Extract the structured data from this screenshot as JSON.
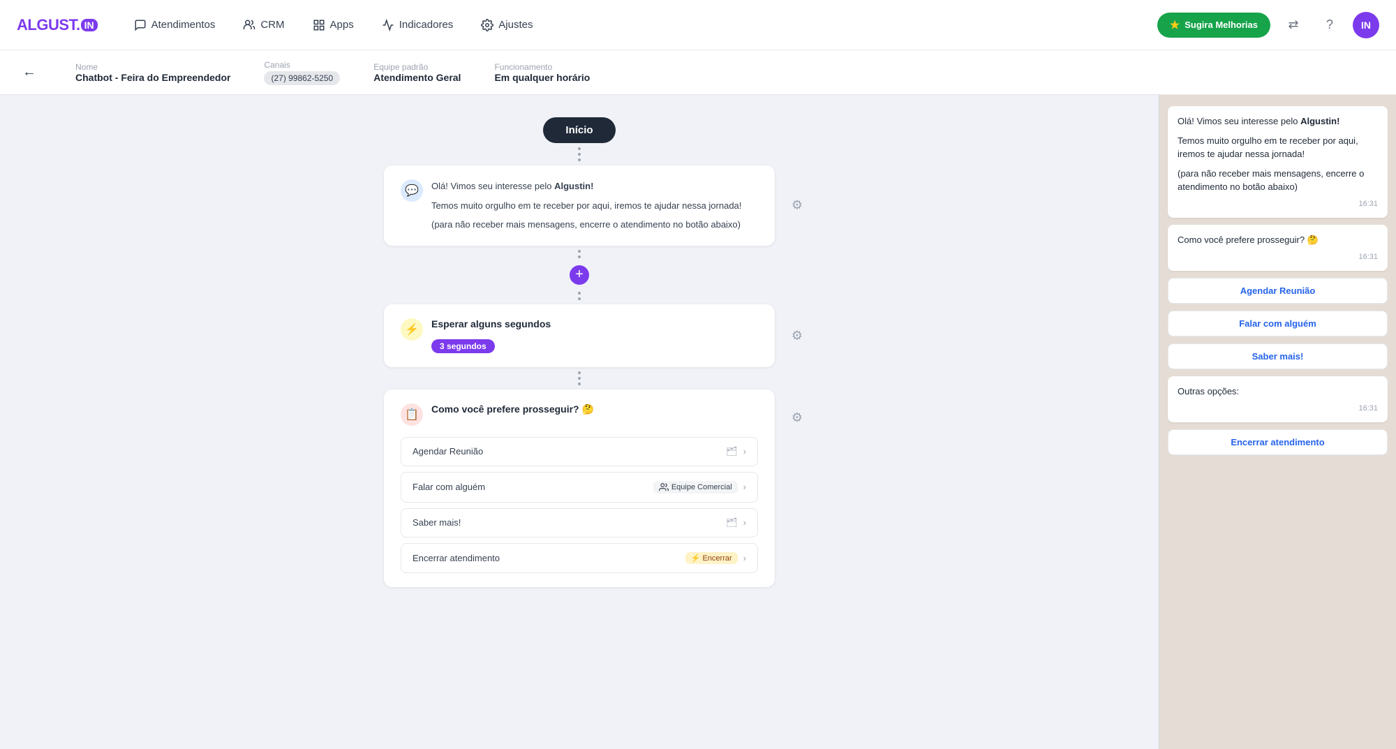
{
  "logo": {
    "text": "ALGUST.",
    "badge": "IN"
  },
  "nav": {
    "items": [
      {
        "id": "atendimentos",
        "label": "Atendimentos",
        "icon": "chat"
      },
      {
        "id": "crm",
        "label": "CRM",
        "icon": "users"
      },
      {
        "id": "apps",
        "label": "Apps",
        "icon": "grid"
      },
      {
        "id": "indicadores",
        "label": "Indicadores",
        "icon": "chart"
      },
      {
        "id": "ajustes",
        "label": "Ajustes",
        "icon": "gear"
      }
    ],
    "suggest_label": "Sugira Melhorias",
    "avatar_initials": "IN"
  },
  "subheader": {
    "back_label": "←",
    "name_label": "Nome",
    "name_value": "Chatbot - Feira do Empreendedor",
    "canais_label": "Canais",
    "canal_value": "(27) 99862-5250",
    "equipe_label": "Equipe padrão",
    "equipe_value": "Atendimento Geral",
    "funcionamento_label": "Funcionamento",
    "funcionamento_value": "Em qualquer horário"
  },
  "flow": {
    "start_label": "Início",
    "nodes": [
      {
        "id": "message-node",
        "type": "message",
        "icon": "💬",
        "icon_color": "blue",
        "lines": [
          {
            "text": "Olá! Vimos seu interesse pelo ",
            "bold": "Algustin!"
          },
          {
            "text": "Temos muito orgulho em te receber por aqui, iremos te ajudar nessa jornada!"
          },
          {
            "text": "(para não receber mais mensagens, encerre o atendimento no botão abaixo)"
          }
        ]
      },
      {
        "id": "wait-node",
        "type": "wait",
        "icon": "⚡",
        "icon_color": "yellow",
        "title": "Esperar alguns segundos",
        "badge": "3 segundos"
      },
      {
        "id": "question-node",
        "type": "question",
        "icon": "📋",
        "icon_color": "red",
        "title": "Como você prefere prosseguir? 🤔",
        "options": [
          {
            "label": "Agendar Reunião",
            "tag_type": "folder",
            "tag": ""
          },
          {
            "label": "Falar com alguém",
            "tag_type": "team",
            "tag": "Equipe Comercial"
          },
          {
            "label": "Saber mais!",
            "tag_type": "folder",
            "tag": ""
          },
          {
            "label": "Encerrar atendimento",
            "tag_type": "encerrar",
            "tag": "Encerrar"
          }
        ]
      }
    ]
  },
  "preview": {
    "messages": [
      {
        "type": "bubble",
        "text_parts": [
          {
            "text": "Olá! Vimos seu interesse pelo ",
            "bold": false
          },
          {
            "text": "Algustin!",
            "bold": true
          }
        ],
        "extra_lines": [
          "Temos muito orgulho em te receber por aqui, iremos te ajudar nessa jornada!",
          "(para não receber mais mensagens, encerre o atendimento no botão abaixo)"
        ],
        "time": "16:31"
      },
      {
        "type": "bubble",
        "text_parts": [
          {
            "text": "Como você prefere prosseguir? 🤔",
            "bold": false
          }
        ],
        "extra_lines": [],
        "time": "16:31"
      }
    ],
    "buttons": [
      {
        "label": "Agendar Reunião"
      },
      {
        "label": "Falar com alguém"
      },
      {
        "label": "Saber mais!"
      }
    ],
    "outras_label": "Outras opções:",
    "outras_time": "16:31",
    "encerrar_label": "Encerrar atendimento"
  }
}
